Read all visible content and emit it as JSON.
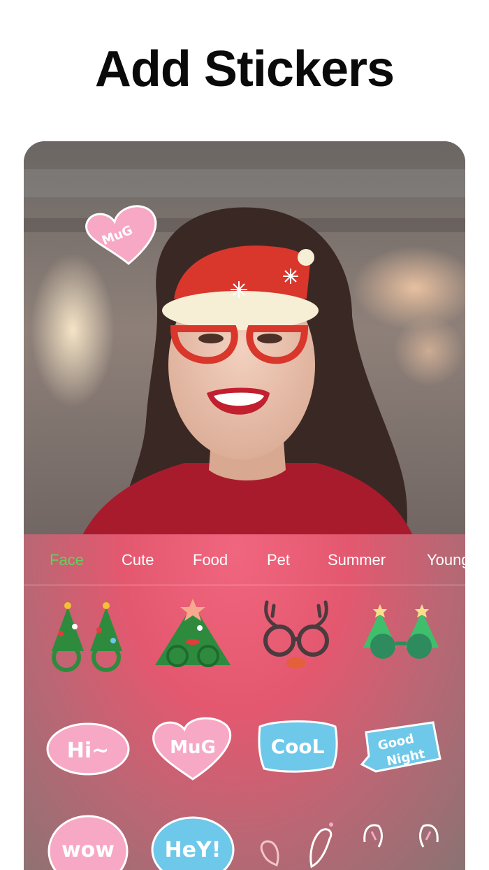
{
  "title": "Add Stickers",
  "photo_stickers": {
    "heart_text": "MuG"
  },
  "tabs": [
    {
      "label": "Face",
      "active": true
    },
    {
      "label": "Cute",
      "active": false
    },
    {
      "label": "Food",
      "active": false
    },
    {
      "label": "Pet",
      "active": false
    },
    {
      "label": "Summer",
      "active": false
    },
    {
      "label": "Young",
      "active": false
    }
  ],
  "stickers": {
    "hi": "Hi~",
    "mug": "MuG",
    "cool": "CooL",
    "good": "Good",
    "night": "Night",
    "wow": "wow",
    "hey": "HeY!"
  },
  "colors": {
    "active_tab": "#5ed35a",
    "panel": "#e4586f",
    "sticker_pink": "#f7a8c4",
    "sticker_blue": "#6ec8ea",
    "tree_green": "#2e8b3e"
  }
}
